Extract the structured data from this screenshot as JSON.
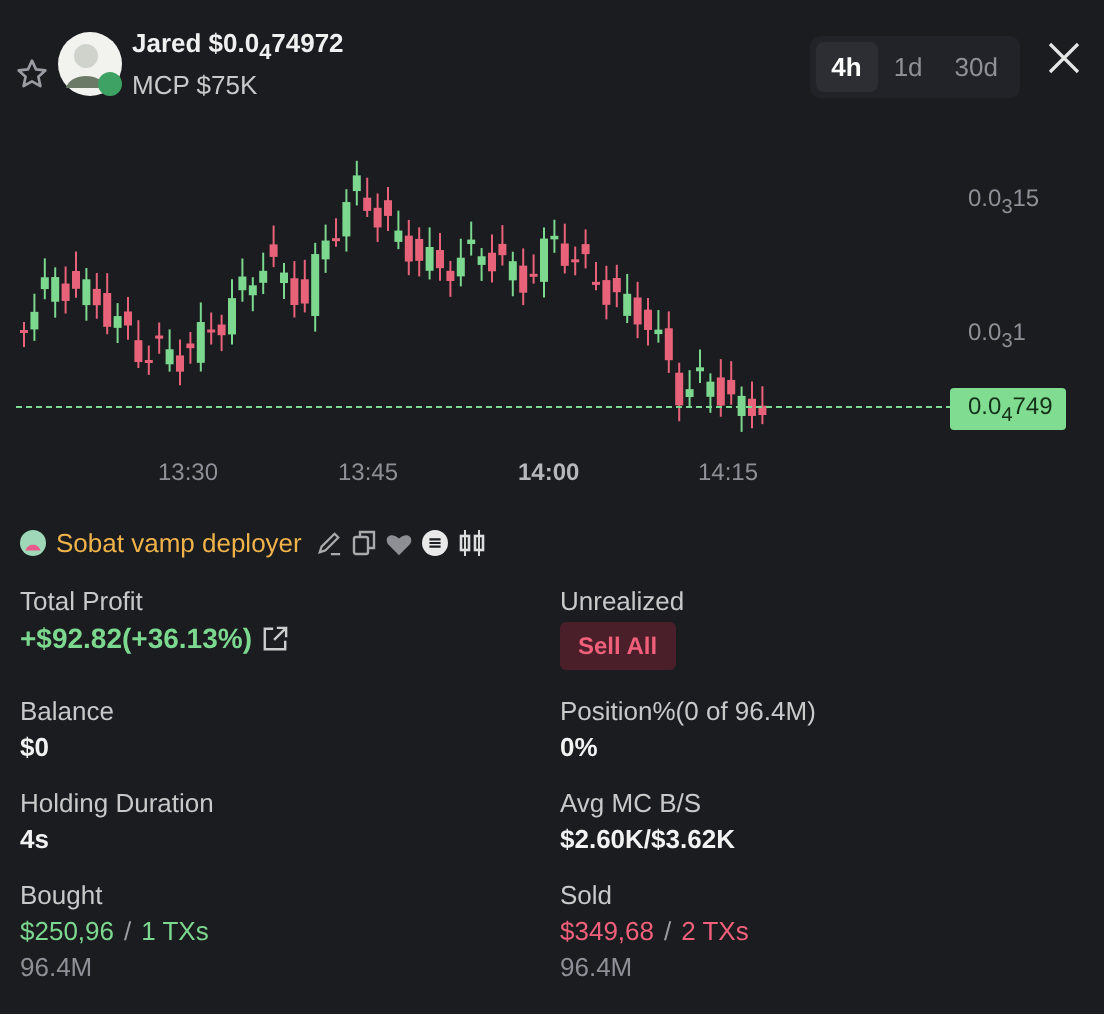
{
  "token": {
    "name": "Jared",
    "price": "$0.0$_{4}$74972",
    "mcp": "MCP $75K",
    "favorite": false
  },
  "timeframes": [
    {
      "label": "4h",
      "selected": true
    },
    {
      "label": "1d",
      "selected": false
    },
    {
      "label": "30d",
      "selected": false
    }
  ],
  "chart": {
    "y_labels": [
      "0.0$_{3}$15",
      "0.0$_{3}$1"
    ],
    "price_tag": "0.0$_{4}$749",
    "x_labels": [
      {
        "label": "13:30",
        "bold": false
      },
      {
        "label": "13:45",
        "bold": false
      },
      {
        "label": "14:00",
        "bold": true
      },
      {
        "label": "14:15",
        "bold": false
      }
    ]
  },
  "deployer": {
    "name": "Sobat vamp deployer"
  },
  "stats": [
    {
      "kind": "profit",
      "label": "Total Profit",
      "value": "+$92.82(+36.13%)"
    },
    {
      "kind": "button",
      "label": "Unrealized",
      "button": "Sell All"
    },
    {
      "kind": "plain",
      "label": "Balance",
      "value": "$0"
    },
    {
      "kind": "plain",
      "label": "Position%(0 of 96.4M)",
      "value": "0%"
    },
    {
      "kind": "plain",
      "label": "Holding Duration",
      "value": "4s"
    },
    {
      "kind": "plain",
      "label": "Avg MC B/S",
      "value": "$2.60K/$3.62K"
    },
    {
      "kind": "bought",
      "label": "Bought",
      "amount": "$250,96",
      "separator": "/",
      "txs": "1 TXs",
      "volume": "96.4M"
    },
    {
      "kind": "sold",
      "label": "Sold",
      "amount": "$349,68",
      "separator": "/",
      "txs": "2 TXs",
      "volume": "96.4M"
    }
  ]
}
